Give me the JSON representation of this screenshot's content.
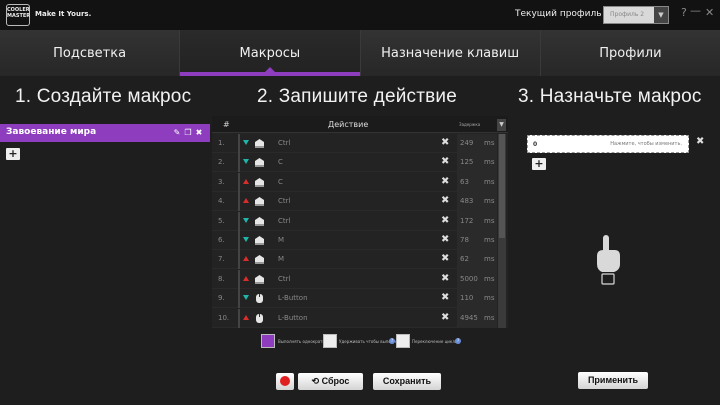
{
  "titlebar": {
    "logo_text": "COOLER MASTER",
    "tagline": "Make It Yours.",
    "profile_label": "Текущий профиль",
    "profile_value": "Профиль 2",
    "help": "?",
    "minimize": "—",
    "close": "✕"
  },
  "tabs": [
    {
      "label": "Подсветка"
    },
    {
      "label": "Макросы"
    },
    {
      "label": "Назначение клавиш"
    },
    {
      "label": "Профили"
    }
  ],
  "active_tab": "Макросы",
  "accent_color": "#8e3dbf",
  "left": {
    "title": "1. Создайте макрос",
    "macros": [
      {
        "name": "Завоевание мира"
      }
    ],
    "add": "+"
  },
  "middle": {
    "title": "2. Запишите действие",
    "headers": {
      "num": "#",
      "action": "Действие",
      "duration": "Задержка"
    },
    "rows": [
      {
        "num": "1.",
        "dir": "down",
        "icon": "key-icon",
        "label": "Ctrl",
        "dur": "249",
        "unit": "ms"
      },
      {
        "num": "2.",
        "dir": "down",
        "icon": "key-icon",
        "label": "C",
        "dur": "125",
        "unit": "ms"
      },
      {
        "num": "3.",
        "dir": "up",
        "icon": "key-icon",
        "label": "C",
        "dur": "63",
        "unit": "ms"
      },
      {
        "num": "4.",
        "dir": "up",
        "icon": "key-icon",
        "label": "Ctrl",
        "dur": "483",
        "unit": "ms"
      },
      {
        "num": "5.",
        "dir": "down",
        "icon": "key-icon",
        "label": "Ctrl",
        "dur": "172",
        "unit": "ms"
      },
      {
        "num": "6.",
        "dir": "down",
        "icon": "key-icon",
        "label": "M",
        "dur": "78",
        "unit": "ms"
      },
      {
        "num": "7.",
        "dir": "up",
        "icon": "key-icon",
        "label": "M",
        "dur": "62",
        "unit": "ms"
      },
      {
        "num": "8.",
        "dir": "up",
        "icon": "key-icon",
        "label": "Ctrl",
        "dur": "5000",
        "unit": "ms"
      },
      {
        "num": "9.",
        "dir": "down",
        "icon": "mouse-icon",
        "label": "L-Button",
        "dur": "110",
        "unit": "ms"
      },
      {
        "num": "10.",
        "dir": "up",
        "icon": "mouse-icon",
        "label": "L-Button",
        "dur": "4945",
        "unit": "ms"
      }
    ],
    "options": [
      {
        "label": "Выполнять однократно",
        "checked": true
      },
      {
        "label": "Удерживать чтобы выполнить",
        "checked": false
      },
      {
        "label": "Переключение цикла",
        "checked": false
      }
    ],
    "reset_label": "Сброс",
    "save_label": "Сохранить"
  },
  "right": {
    "title": "3. Назначьте макрос",
    "assign_key": "0",
    "assign_hint": "Нажмите, чтобы изменить.",
    "add": "+",
    "apply_label": "Применить"
  }
}
